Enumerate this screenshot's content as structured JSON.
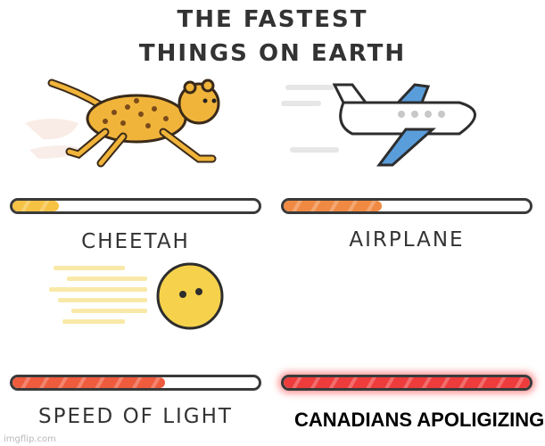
{
  "title": {
    "line1": "THE FASTEST",
    "line2": "THINGS ON EARTH"
  },
  "panels": [
    {
      "label": "CHEETAH",
      "speed_fraction": 0.19,
      "fill_color": "#f6c244"
    },
    {
      "label": "AIRPLANE",
      "speed_fraction": 0.4,
      "fill_color": "#f08a43"
    },
    {
      "label": "SPEED OF LIGHT",
      "speed_fraction": 0.62,
      "fill_color": "#ef5b3d"
    },
    {
      "label": "",
      "speed_fraction": 1.0,
      "fill_color": "#ee3b3b"
    }
  ],
  "caption": "CANADIANS APOLIGIZING",
  "watermark": "imgflip.com",
  "icons": [
    "cheetah-icon",
    "airplane-icon",
    "light-ball-icon"
  ]
}
